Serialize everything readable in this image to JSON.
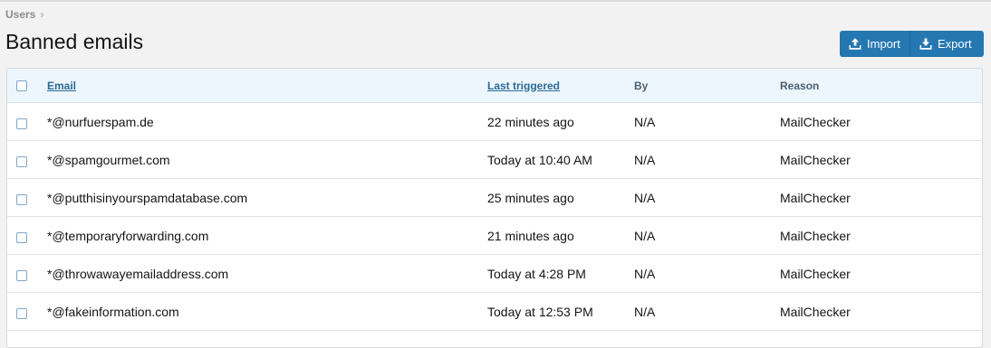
{
  "breadcrumb": {
    "label": "Users",
    "separator": "›"
  },
  "page_title": "Banned emails",
  "toolbar": {
    "import_label": "Import",
    "export_label": "Export"
  },
  "table": {
    "columns": {
      "email": "Email",
      "last_triggered": "Last triggered",
      "by": "By",
      "reason": "Reason"
    },
    "rows": [
      {
        "email": "*@nurfuerspam.de",
        "last_triggered": "22 minutes ago",
        "by": "N/A",
        "reason": "MailChecker"
      },
      {
        "email": "*@spamgourmet.com",
        "last_triggered": "Today at 10:40 AM",
        "by": "N/A",
        "reason": "MailChecker"
      },
      {
        "email": "*@putthisinyourspamdatabase.com",
        "last_triggered": "25 minutes ago",
        "by": "N/A",
        "reason": "MailChecker"
      },
      {
        "email": "*@temporaryforwarding.com",
        "last_triggered": "21 minutes ago",
        "by": "N/A",
        "reason": "MailChecker"
      },
      {
        "email": "*@throwawayemailaddress.com",
        "last_triggered": "Today at 4:28 PM",
        "by": "N/A",
        "reason": "MailChecker"
      },
      {
        "email": "*@fakeinformation.com",
        "last_triggered": "Today at 12:53 PM",
        "by": "N/A",
        "reason": "MailChecker"
      }
    ]
  },
  "colors": {
    "accent": "#2577b1",
    "header_bg": "#edf6fd",
    "page_bg": "#f2f2f2"
  }
}
